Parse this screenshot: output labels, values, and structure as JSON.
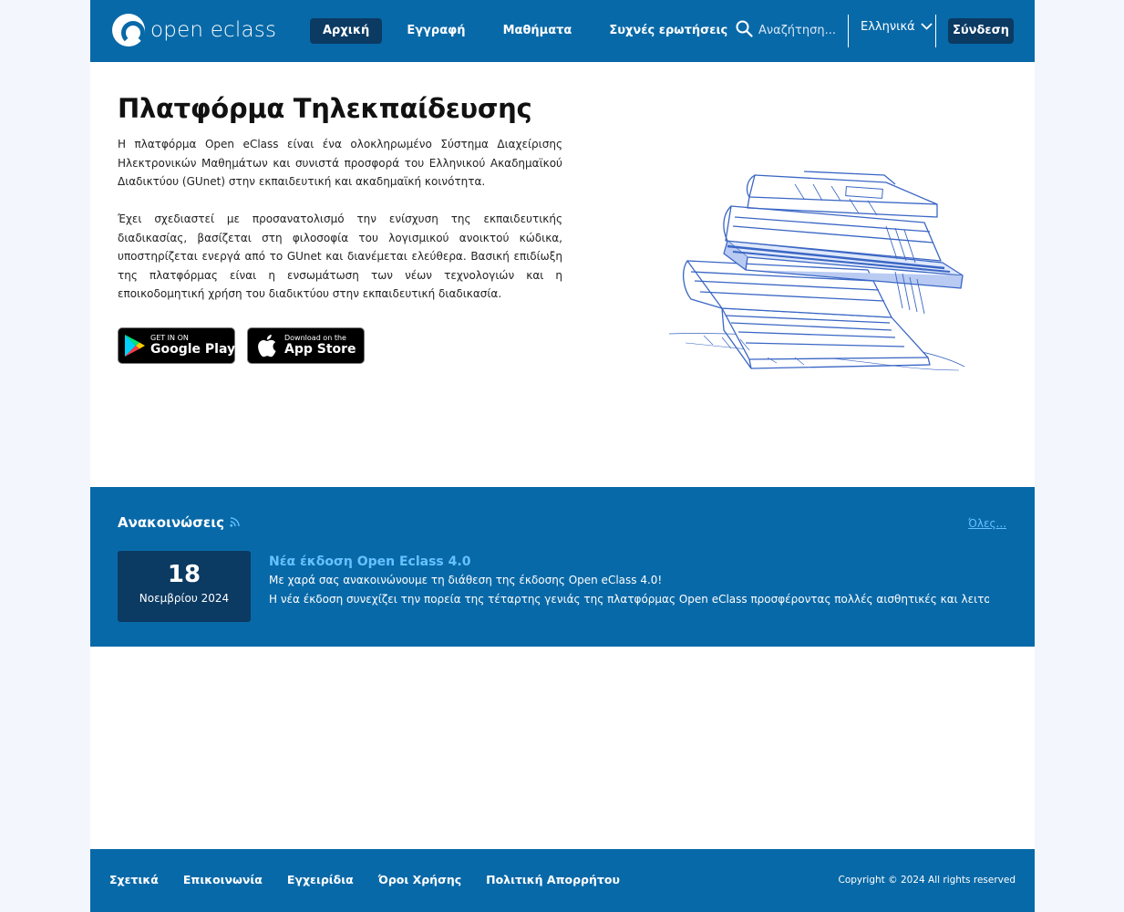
{
  "header": {
    "logo_text": "open eclass",
    "nav": [
      {
        "label": "Αρχική",
        "active": true
      },
      {
        "label": "Εγγραφή",
        "active": false
      },
      {
        "label": "Μαθήματα",
        "active": false
      },
      {
        "label": "Συχνές ερωτήσεις",
        "active": false
      }
    ],
    "search_placeholder": "Αναζήτηση...",
    "language": "Ελληνικά",
    "login_label": "Σύνδεση"
  },
  "hero": {
    "title": "Πλατφόρμα Τηλεκπαίδευσης",
    "paragraph1": "Η πλατφόρμα Open eClass είναι ένα ολοκληρωμένο Σύστημα Διαχείρισης Ηλεκτρονικών Μαθημάτων και συνιστά προσφορά του Ελληνικού Ακαδημαϊκού Διαδικτύου (GUnet) στην εκπαιδευτική και ακαδημαϊκή κοινότητα.",
    "paragraph2": "Έχει σχεδιαστεί με προσανατολισμό την ενίσχυση της εκπαιδευτικής διαδικασίας, βασίζεται στη φιλοσοφία του λογισμικού ανοικτού κώδικα, υποστηρίζεται ενεργά από το GUnet και διανέμεται ελεύθερα. Βασική επιδίωξη της πλατφόρμας είναι η ενσωμάτωση των νέων τεχνολογιών και η εποικοδομητική χρήση του διαδικτύου στην εκπαιδευτική διαδικασία.",
    "google_play": {
      "small": "GET IN ON",
      "big": "Google Play"
    },
    "app_store": {
      "small": "Download on the",
      "big": "App Store"
    }
  },
  "announcements": {
    "title": "Ανακοινώσεις",
    "all_link": "Όλες...",
    "items": [
      {
        "day": "18",
        "month_year": "Νοεμβρίου 2024",
        "title": "Νέα έκδοση Open Eclass 4.0",
        "line1": "Με χαρά σας ανακοινώνουμε τη διάθεση της έκδοσης Open eClass 4.0!",
        "line2": "Η νέα έκδοση συνεχίζει την πορεία της τέταρτης γενιάς της πλατφόρμας Open eClass προσφέροντας πολλές αισθητικές και λειτουργικές..."
      }
    ]
  },
  "footer": {
    "links": [
      "Σχετικά",
      "Επικοινωνία",
      "Εγχειρίδια",
      "Όροι Χρήσης",
      "Πολιτική Απορρήτου"
    ],
    "copyright": "Copyright © 2024 All rights reserved"
  },
  "colors": {
    "brand_blue": "#0869a8",
    "dark_navy": "#0b3a63",
    "link_blue": "#66c2ff"
  }
}
